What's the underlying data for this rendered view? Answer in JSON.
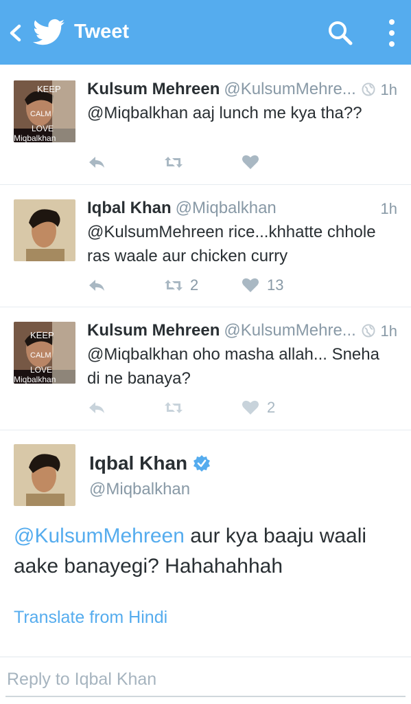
{
  "header": {
    "title": "Tweet",
    "back_icon": "chevron-left-icon",
    "logo_icon": "twitter-bird-icon",
    "search_icon": "search-icon",
    "menu_icon": "more-vertical-icon",
    "bg_color": "#55acee"
  },
  "tweets": [
    {
      "name": "Kulsum Mehreen",
      "handle": "@KulsumMehre...",
      "time": "1h",
      "text": "@Miqbalkhan aaj lunch me kya tha??",
      "retweets": "",
      "likes": "",
      "avatar_caption": "KEEP CALM AND LOVE Miqbalkhan",
      "avatar_lines": [
        "KEEP",
        "CALM",
        "LOVE",
        "Miqbalkhan"
      ]
    },
    {
      "name": "Iqbal Khan",
      "handle": "@Miqbalkhan",
      "time": "1h",
      "text": "@KulsumMehreen rice...khhatte chhole ras waale aur chicken curry",
      "retweets": "2",
      "likes": "13"
    },
    {
      "name": "Kulsum Mehreen",
      "handle": "@KulsumMehre...",
      "time": "1h",
      "text": "@Miqbalkhan oho masha allah... Sneha di ne banaya?",
      "retweets": "",
      "likes": "2",
      "avatar_lines": [
        "KEEP",
        "CALM",
        "LOVE",
        "Miqbalkhan"
      ]
    }
  ],
  "main_tweet": {
    "name": "Iqbal Khan",
    "handle": "@Miqbalkhan",
    "verified": true,
    "mention": "@KulsumMehreen",
    "text": " aur kya baaju waali aake banayegi? Hahahahhah",
    "translate": "Translate from Hindi"
  },
  "reply": {
    "placeholder": "Reply to Iqbal Khan"
  },
  "colors": {
    "accent": "#55acee",
    "muted": "#8899a6",
    "text": "#292f33"
  }
}
